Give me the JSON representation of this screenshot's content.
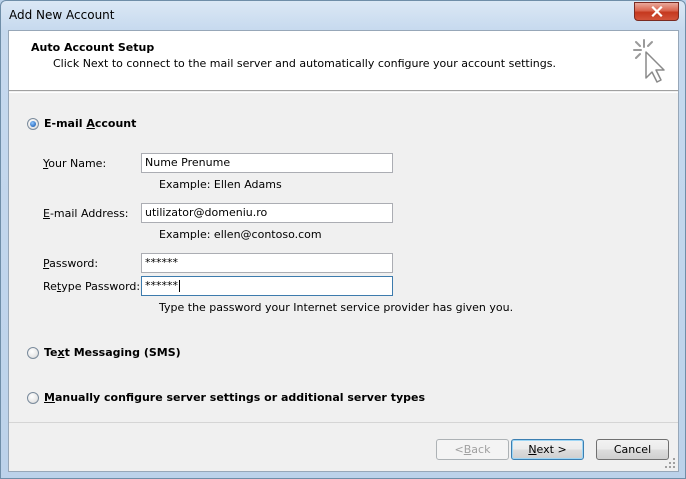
{
  "window": {
    "title": "Add New Account"
  },
  "header": {
    "title": "Auto Account Setup",
    "subtitle": "Click Next to connect to the mail server and automatically configure your account settings."
  },
  "options": {
    "email_account": {
      "pre": "E-mail ",
      "accel": "A",
      "post": "ccount",
      "selected": true
    },
    "text_messaging": {
      "pre": "Te",
      "accel": "x",
      "post": "t Messaging (SMS)",
      "selected": false
    },
    "manual": {
      "pre": "",
      "accel": "M",
      "post": "anually configure server settings or additional server types",
      "selected": false
    }
  },
  "form": {
    "your_name": {
      "label_accel": "Y",
      "label_rest": "our Name:",
      "value": "Nume Prenume",
      "example": "Example: Ellen Adams"
    },
    "email": {
      "label_accel": "E",
      "label_rest": "-mail Address:",
      "value": "utilizator@domeniu.ro",
      "example": "Example: ellen@contoso.com"
    },
    "password": {
      "label_accel": "P",
      "label_rest": "assword:",
      "value": "******"
    },
    "retype": {
      "label_pre": "Re",
      "label_accel": "t",
      "label_rest": "ype Password:",
      "value": "******",
      "hint": "Type the password your Internet service provider has given you."
    }
  },
  "buttons": {
    "back": {
      "pre": "< ",
      "accel": "B",
      "post": "ack"
    },
    "next": {
      "accel": "N",
      "post": "ext >"
    },
    "cancel": "Cancel"
  }
}
